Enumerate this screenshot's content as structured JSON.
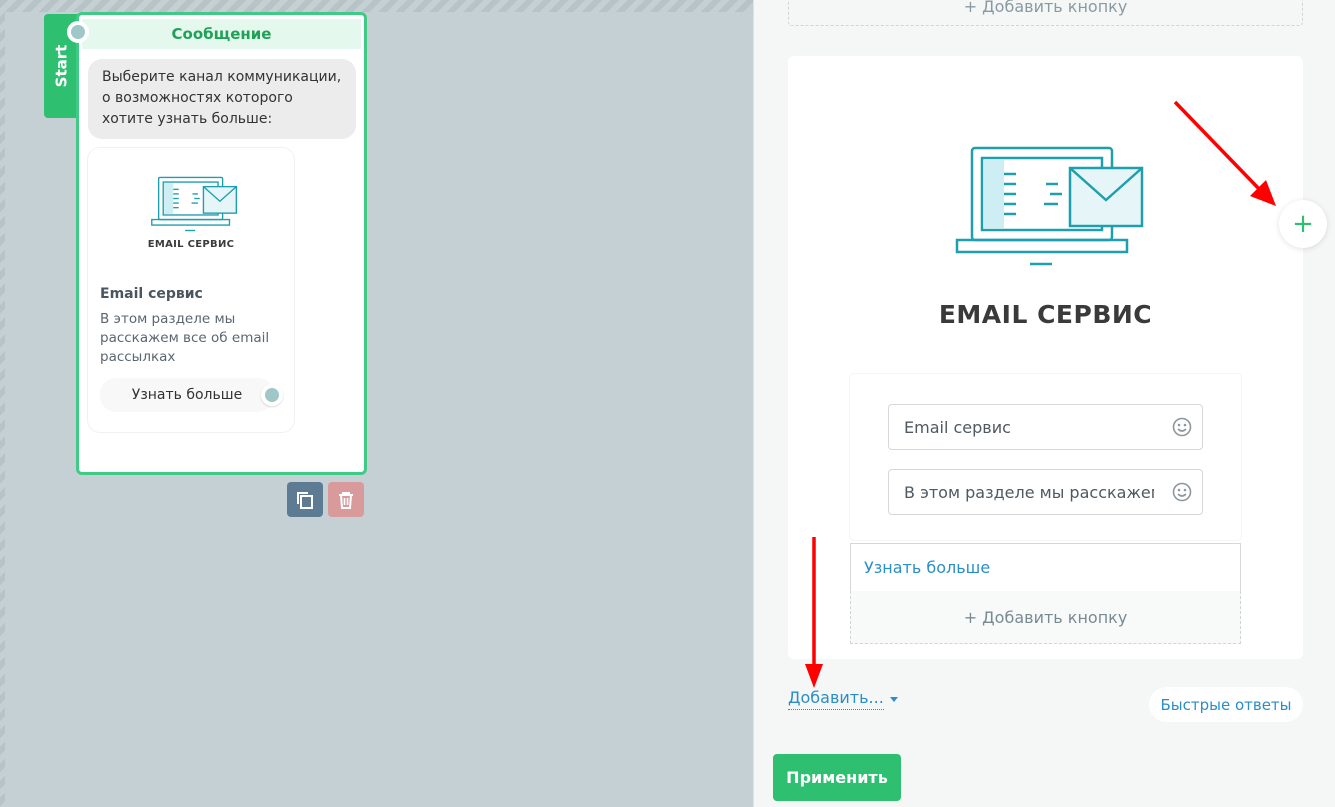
{
  "canvas": {
    "start_label": "Start",
    "node": {
      "header": "Сообщение",
      "message_text": "Выберите канал коммуникации, о возможностях которого хотите узнать больше:",
      "card": {
        "image_caption": "EMAIL СЕРВИС",
        "title": "Email сервис",
        "description": "В этом разделе мы расскажем все об email рассылках",
        "button_label": "Узнать больше"
      }
    }
  },
  "panel": {
    "top_add_button_label": "+ Добавить кнопку",
    "card_editor": {
      "image_caption": "EMAIL СЕРВИС",
      "title_value": "Email сервис",
      "description_value": "В этом разделе мы расскажем все об email рассылках",
      "buttons": [
        {
          "label": "Узнать больше"
        }
      ],
      "add_button_label": "+ Добавить кнопку",
      "add_card_symbol": "+"
    },
    "add_dropdown_label": "Добавить...",
    "quick_replies_label": "Быстрые ответы",
    "apply_label": "Применить"
  },
  "colors": {
    "accent_green": "#2fbf71",
    "link_blue": "#2a8ec9",
    "annotation_red": "#ff0000",
    "illustration_teal": "#1e9fae"
  }
}
